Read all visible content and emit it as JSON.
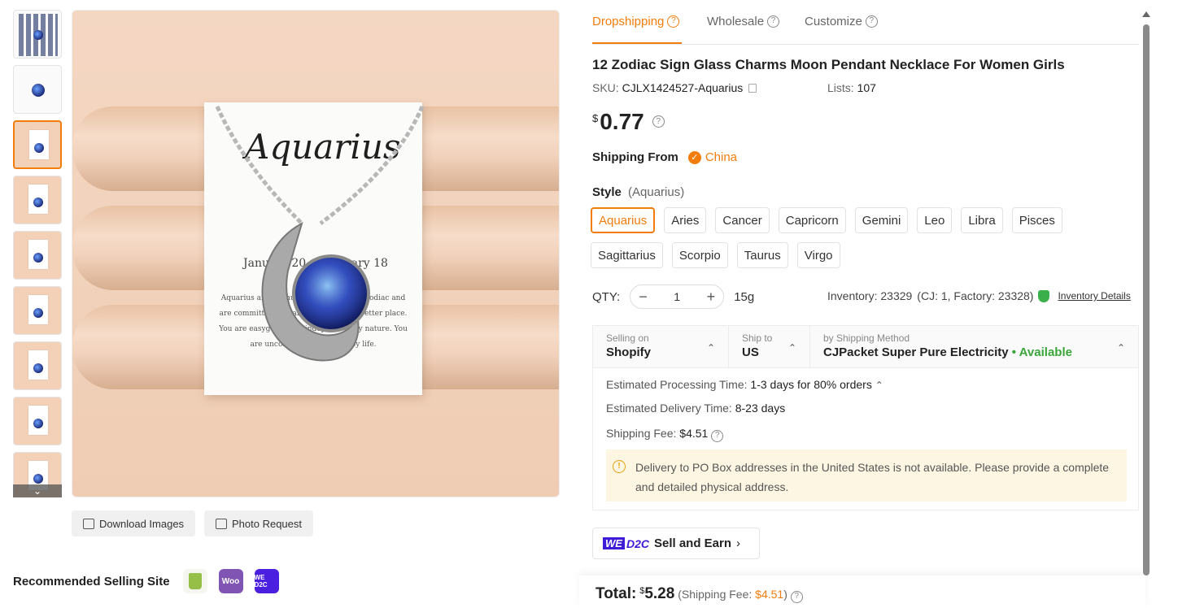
{
  "tabs": [
    {
      "label": "Dropshipping",
      "active": true
    },
    {
      "label": "Wholesale",
      "active": false
    },
    {
      "label": "Customize",
      "active": false
    }
  ],
  "product": {
    "title": "12 Zodiac Sign Glass Charms Moon Pendant Necklace For Women Girls",
    "sku_label": "SKU:",
    "sku_value": "CJLX1424527-Aquarius",
    "lists_label": "Lists:",
    "lists_value": "107",
    "price_currency": "$",
    "price": "0.77"
  },
  "shipping_from": {
    "label": "Shipping From",
    "value": "China"
  },
  "style": {
    "label": "Style",
    "selected": "(Aquarius)",
    "options": [
      "Aquarius",
      "Aries",
      "Cancer",
      "Capricorn",
      "Gemini",
      "Leo",
      "Libra",
      "Pisces",
      "Sagittarius",
      "Scorpio",
      "Taurus",
      "Virgo"
    ]
  },
  "qty": {
    "label": "QTY:",
    "value": "1",
    "weight": "15g",
    "inventory": "Inventory: 23329",
    "inventory_detail": "(CJ: 1, Factory: 23328)",
    "inventory_link": "Inventory Details"
  },
  "shipping_box": {
    "selling_on_cap": "Selling on",
    "selling_on": "Shopify",
    "ship_to_cap": "Ship to",
    "ship_to": "US",
    "method_cap": "by Shipping Method",
    "method": "CJPacket Super Pure Electricity",
    "availability": "• Available",
    "processing_label": "Estimated Processing Time:",
    "processing_value": "1-3 days for 80% orders",
    "delivery_label": "Estimated Delivery Time:",
    "delivery_value": "8-23 days",
    "fee_label": "Shipping Fee:",
    "fee_value": "$4.51",
    "notice": "Delivery to PO Box addresses in the United States is not available. Please provide a complete and detailed physical address."
  },
  "sell_earn": {
    "we": "WE",
    "d2c": "D2C",
    "label": "Sell and Earn"
  },
  "total": {
    "label": "Total:",
    "currency": "$",
    "value": "5.28",
    "fee_prefix": "(Shipping Fee:",
    "fee_value": "$4.51",
    "fee_suffix": ")"
  },
  "image_buttons": {
    "download": "Download Images",
    "photo": "Photo Request"
  },
  "recommended": {
    "label": "Recommended Selling Site",
    "sites": [
      "shopify-icon",
      "woocommerce-icon",
      "wed2c-icon"
    ],
    "woo_text": "Woo",
    "wed2c_text": "WE D2C"
  },
  "card": {
    "title": "Aquarius",
    "date": "January 20 - February 18",
    "text": "Aquarius are the humanitarians of the zodiac and are committed to making the world a better place. You are easygoing and independent by nature. You are unconventional and enjoy life."
  },
  "colors": {
    "accent": "#f27d0c",
    "available": "#3aa53a",
    "notice_bg": "#fdf6e3"
  }
}
